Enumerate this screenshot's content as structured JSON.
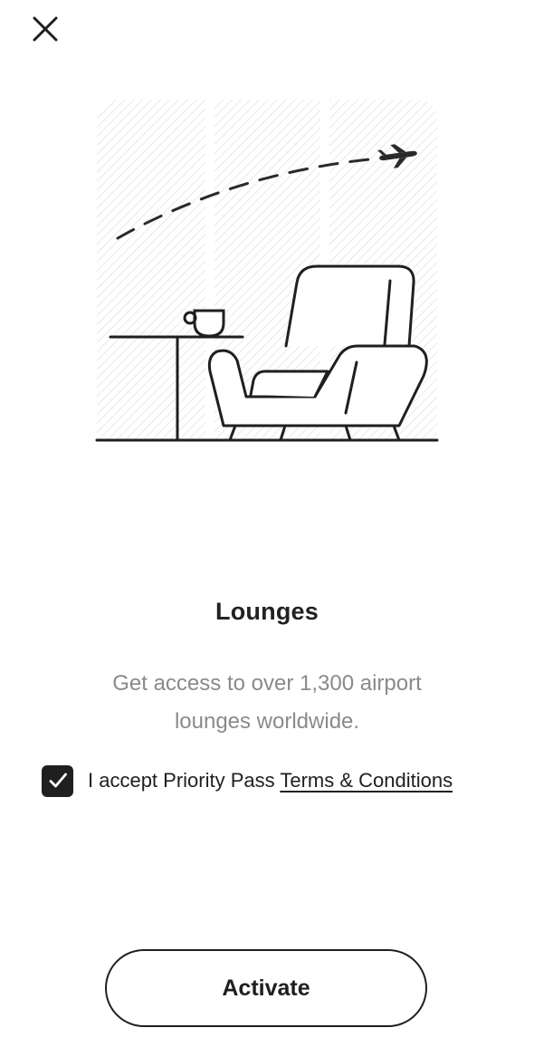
{
  "header": {
    "close_icon": "close-icon"
  },
  "illustration": {
    "icon": "lounge-armchair-airplane-illustration"
  },
  "content": {
    "title": "Lounges",
    "description": "Get access to over 1,300 airport lounges worldwide."
  },
  "consent": {
    "checked": true,
    "text_prefix": "I accept Priority Pass ",
    "link_label": "Terms & Conditions"
  },
  "actions": {
    "activate_label": "Activate"
  },
  "colors": {
    "text": "#1f1f1f",
    "muted_text": "#8a8a8a",
    "background": "#ffffff"
  }
}
